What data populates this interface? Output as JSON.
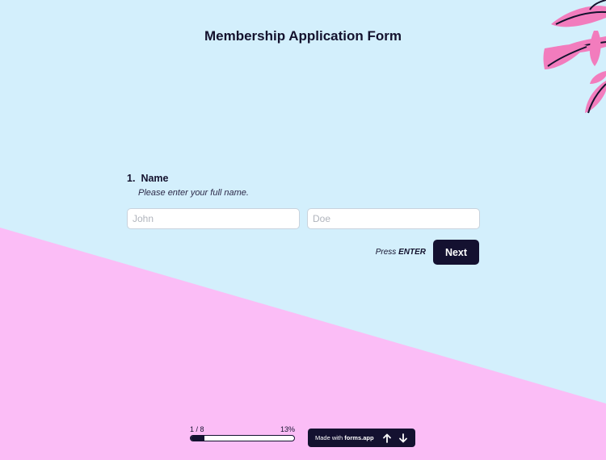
{
  "form": {
    "title": "Membership Application Form"
  },
  "question": {
    "number": "1.",
    "label": "Name",
    "description": "Please enter your full name.",
    "first_name": {
      "value": "",
      "placeholder": "John"
    },
    "last_name": {
      "value": "",
      "placeholder": "Doe"
    }
  },
  "actions": {
    "press_text": "Press",
    "press_key": "ENTER",
    "next_label": "Next"
  },
  "progress": {
    "step_text": "1 / 8",
    "percent_text": "13%",
    "fraction": 0.13
  },
  "footer": {
    "made_with_text": "Made with",
    "brand": "forms.app",
    "prev_icon": "arrow-up-icon",
    "next_icon": "arrow-down-icon"
  },
  "colors": {
    "background_top": "#d3effc",
    "background_bottom": "#fbbdf6",
    "accent_dark": "#141130",
    "leaf_pink": "#f27cbd"
  }
}
